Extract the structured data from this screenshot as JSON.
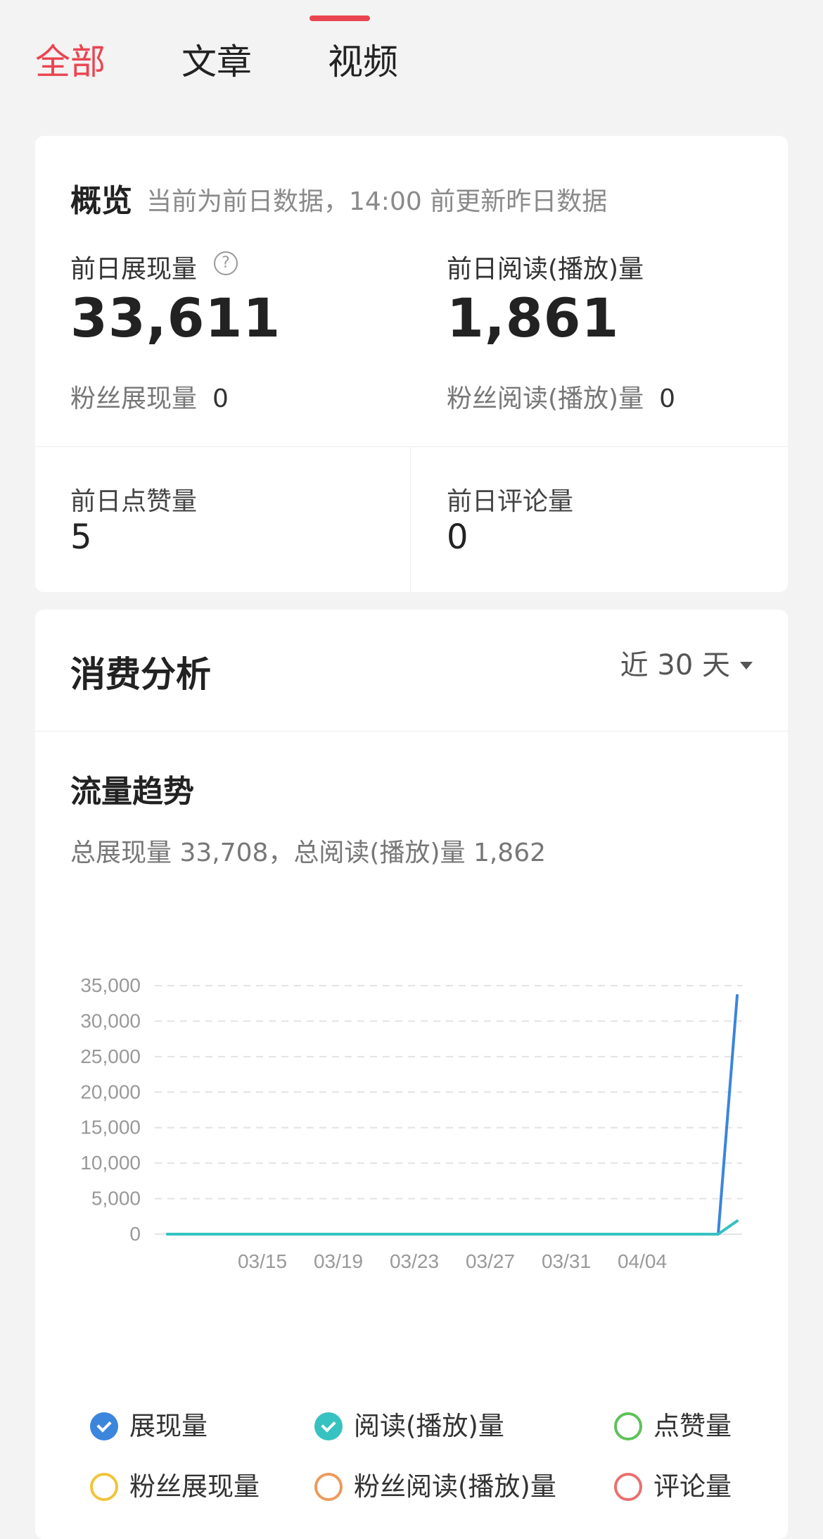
{
  "tabs": [
    {
      "label": "全部",
      "active": true
    },
    {
      "label": "文章",
      "active": false
    },
    {
      "label": "视频",
      "active": false
    }
  ],
  "overview": {
    "title": "概览",
    "subtitle": "当前为前日数据，14:00 前更新昨日数据",
    "impressions": {
      "label": "前日展现量",
      "value": "33,611",
      "fan_label": "粉丝展现量",
      "fan_value": "0"
    },
    "reads": {
      "label": "前日阅读(播放)量",
      "value": "1,861",
      "fan_label": "粉丝阅读(播放)量",
      "fan_value": "0"
    },
    "likes": {
      "label": "前日点赞量",
      "value": "5"
    },
    "comments": {
      "label": "前日评论量",
      "value": "0"
    }
  },
  "analysis": {
    "title": "消费分析",
    "range": "近 30 天",
    "trend_title": "流量趋势",
    "summary": "总展现量 33,708，总阅读(播放)量 1,862"
  },
  "chart_data": {
    "type": "line",
    "x": [
      "03/10",
      "03/11",
      "03/12",
      "03/13",
      "03/14",
      "03/15",
      "03/16",
      "03/17",
      "03/18",
      "03/19",
      "03/20",
      "03/21",
      "03/22",
      "03/23",
      "03/24",
      "03/25",
      "03/26",
      "03/27",
      "03/28",
      "03/29",
      "03/30",
      "03/31",
      "04/01",
      "04/02",
      "04/03",
      "04/04",
      "04/05",
      "04/06",
      "04/07",
      "04/08",
      "04/09"
    ],
    "x_tick_labels": [
      "03/15",
      "03/19",
      "03/23",
      "03/27",
      "03/31",
      "04/04"
    ],
    "y_ticks": [
      0,
      5000,
      10000,
      15000,
      20000,
      25000,
      30000,
      35000
    ],
    "y_tick_labels": [
      "0",
      "5,000",
      "10,000",
      "15,000",
      "20,000",
      "25,000",
      "30,000",
      "35,000"
    ],
    "ylim": [
      0,
      35000
    ],
    "grid": true,
    "series": [
      {
        "name": "展现量",
        "color": "#3b85dd",
        "values": [
          0,
          0,
          0,
          0,
          0,
          0,
          0,
          0,
          0,
          0,
          0,
          0,
          0,
          0,
          0,
          0,
          0,
          0,
          0,
          0,
          0,
          0,
          0,
          0,
          0,
          0,
          0,
          0,
          0,
          0,
          33611
        ]
      },
      {
        "name": "阅读(播放)量",
        "color": "#35c2c0",
        "values": [
          0,
          0,
          0,
          0,
          0,
          0,
          0,
          0,
          0,
          0,
          0,
          0,
          0,
          0,
          0,
          0,
          0,
          0,
          0,
          0,
          0,
          0,
          0,
          0,
          0,
          0,
          0,
          0,
          0,
          0,
          1861
        ]
      }
    ]
  },
  "legend": [
    {
      "label": "展现量",
      "color": "#3b85dd",
      "checked": true
    },
    {
      "label": "阅读(播放)量",
      "color": "#35c2c0",
      "checked": true
    },
    {
      "label": "点赞量",
      "color": "#5fc15a",
      "checked": false
    },
    {
      "label": "粉丝展现量",
      "color": "#f0c43a",
      "checked": false
    },
    {
      "label": "粉丝阅读(播放)量",
      "color": "#ec9a5c",
      "checked": false
    },
    {
      "label": "评论量",
      "color": "#e87070",
      "checked": false
    }
  ]
}
